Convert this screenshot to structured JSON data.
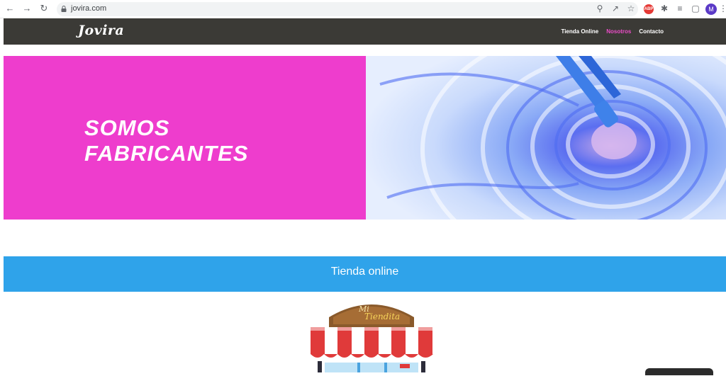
{
  "browser": {
    "url": "jovira.com",
    "extension_badge": "ABP",
    "profile_initial": "M"
  },
  "header": {
    "logo": "Jovira",
    "nav": [
      {
        "label": "Tienda Online",
        "active": false
      },
      {
        "label": "Nosotros",
        "active": true
      },
      {
        "label": "Contacto",
        "active": false
      }
    ]
  },
  "hero": {
    "title_line1": "SOMOS",
    "title_line2": "FABRICANTES",
    "bg_color": "#ee3dcd",
    "image": "blue-paint-swirl"
  },
  "section": {
    "title": "Tienda online",
    "bg_color": "#2fa3ea"
  },
  "store_sign": {
    "line1": "Mi",
    "line2": "Tiendita"
  },
  "colors": {
    "header_bg": "#3b3a36",
    "nav_active": "#ec4cc8"
  }
}
